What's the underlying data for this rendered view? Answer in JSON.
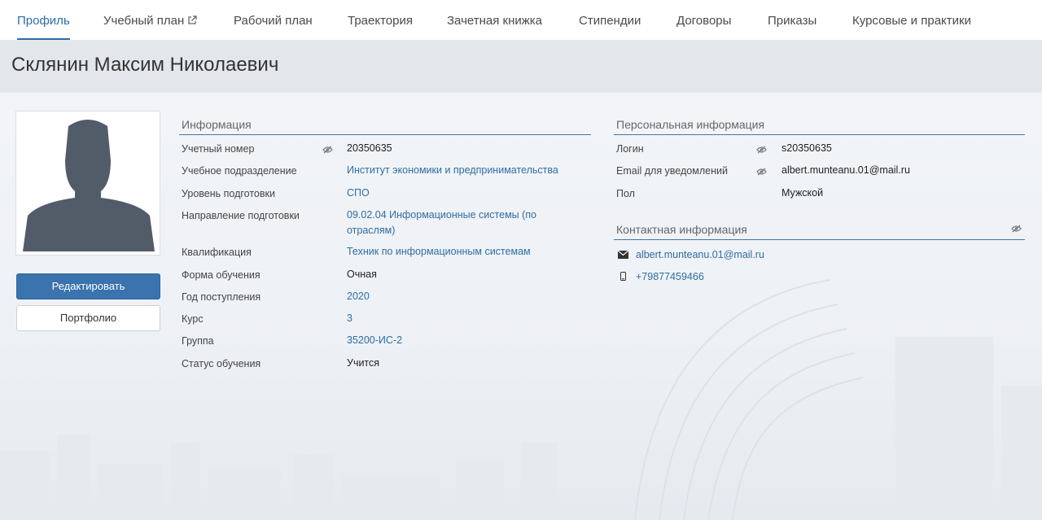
{
  "nav": {
    "tabs": [
      {
        "label": "Профиль",
        "active": true
      },
      {
        "label": "Учебный план",
        "external": true
      },
      {
        "label": "Рабочий план"
      },
      {
        "label": "Траектория"
      },
      {
        "label": "Зачетная книжка"
      },
      {
        "label": "Стипендии"
      },
      {
        "label": "Договоры"
      },
      {
        "label": "Приказы"
      },
      {
        "label": "Курсовые и практики"
      }
    ]
  },
  "page": {
    "title": "Склянин Максим Николаевич"
  },
  "sidebar": {
    "avatar_icon": "user-silhouette-icon",
    "edit_label": "Редактировать",
    "portfolio_label": "Портфолио"
  },
  "info": {
    "title": "Информация",
    "rows": [
      {
        "label": "Учетный номер",
        "value": "20350635",
        "link": false,
        "eye": true
      },
      {
        "label": "Учебное подразделение",
        "value": "Институт экономики и предпринимательства",
        "link": true
      },
      {
        "label": "Уровень подготовки",
        "value": "СПО",
        "link": true
      },
      {
        "label": "Направление подготовки",
        "value": "09.02.04 Информационные системы (по отраслям)",
        "link": true
      },
      {
        "label": "Квалификация",
        "value": "Техник по информационным системам",
        "link": true
      },
      {
        "label": "Форма обучения",
        "value": "Очная",
        "link": false
      },
      {
        "label": "Год поступления",
        "value": "2020",
        "link": true
      },
      {
        "label": "Курс",
        "value": "3",
        "link": true
      },
      {
        "label": "Группа",
        "value": "35200-ИС-2",
        "link": true
      },
      {
        "label": "Статус обучения",
        "value": "Учится",
        "link": false
      }
    ]
  },
  "personal": {
    "title": "Персональная информация",
    "rows": [
      {
        "label": "Логин",
        "value": "s20350635",
        "eye": true
      },
      {
        "label": "Email для уведомлений",
        "value": "albert.munteanu.01@mail.ru",
        "eye": true
      },
      {
        "label": "Пол",
        "value": "Мужской"
      }
    ]
  },
  "contact": {
    "title": "Контактная информация",
    "email": "albert.munteanu.01@mail.ru",
    "phone": "+79877459466"
  },
  "colors": {
    "accent": "#2e6da4",
    "button": "#3a73ad",
    "header_band": "#e3e6ea"
  }
}
